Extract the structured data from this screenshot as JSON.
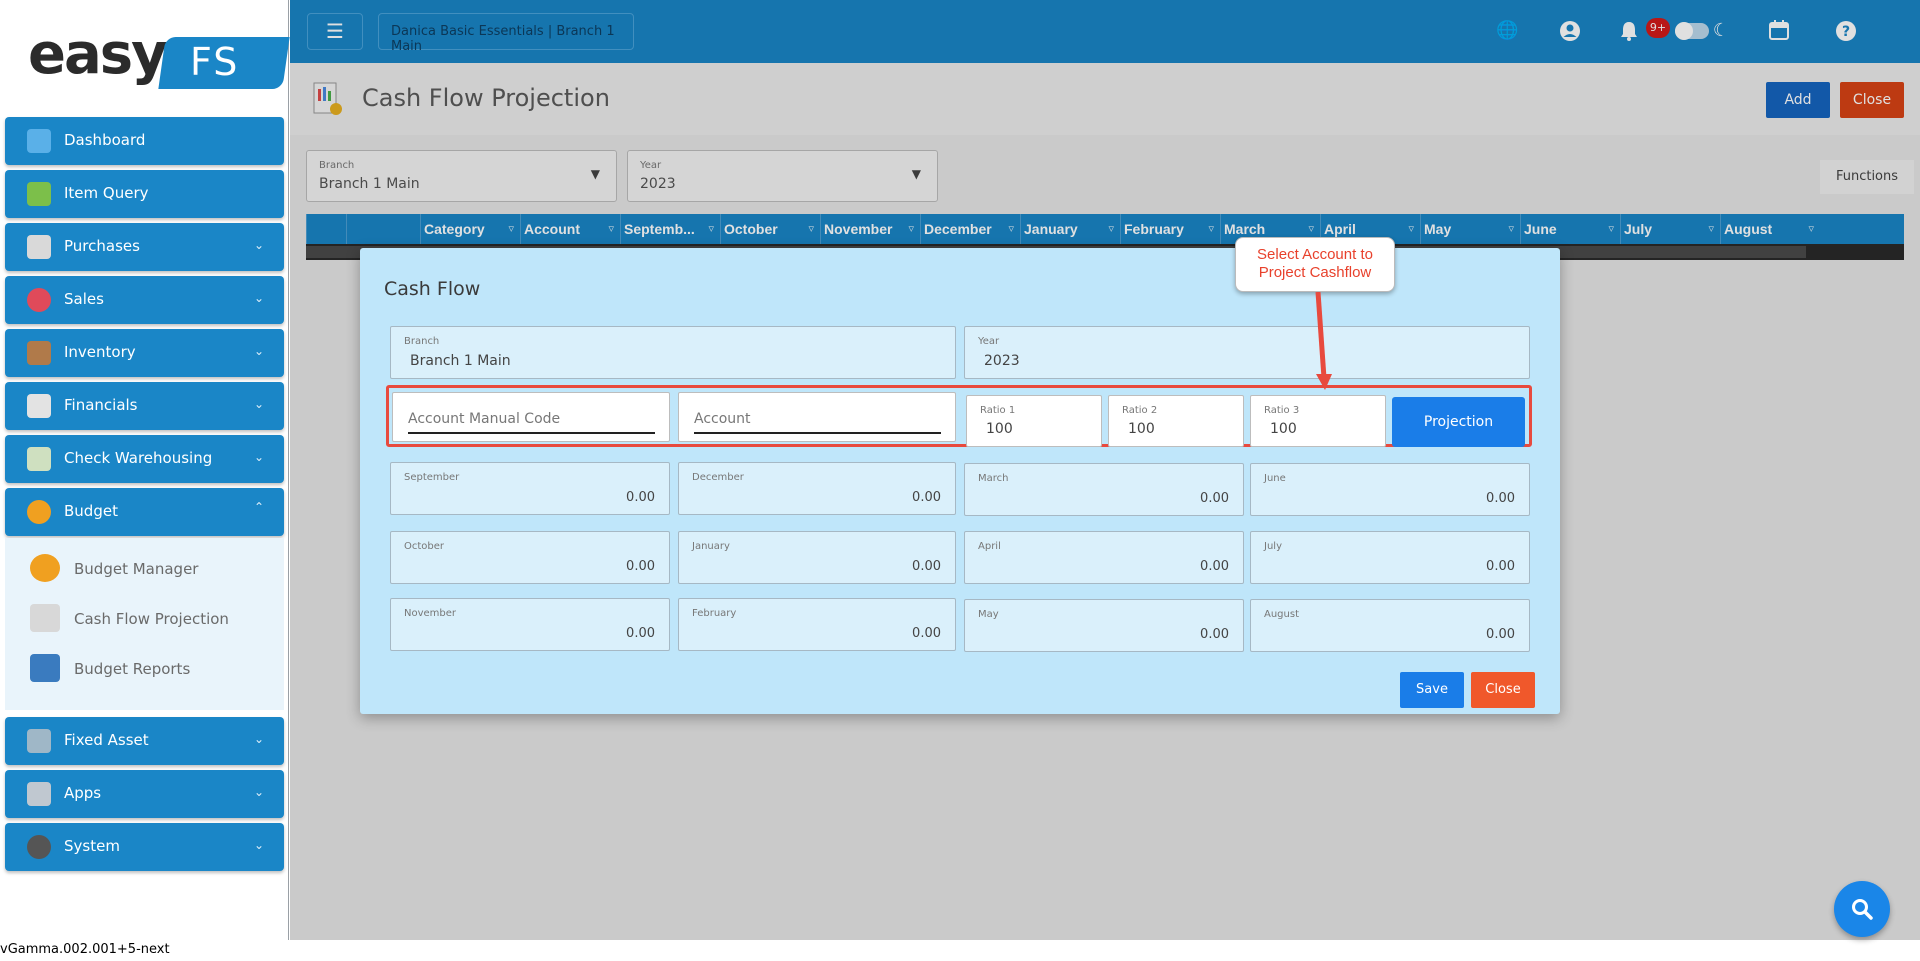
{
  "sidebar": {
    "logo_text": "easy",
    "logo_suffix": "FS",
    "items": [
      {
        "label": "Dashboard",
        "icon": "dashboard-icon"
      },
      {
        "label": "Item Query",
        "icon": "basket-icon"
      },
      {
        "label": "Purchases",
        "icon": "receipt-icon"
      },
      {
        "label": "Sales",
        "icon": "sale-tag-icon"
      },
      {
        "label": "Inventory",
        "icon": "boxes-icon"
      },
      {
        "label": "Financials",
        "icon": "ledger-icon"
      },
      {
        "label": "Check Warehousing",
        "icon": "check-icon"
      },
      {
        "label": "Budget",
        "icon": "pie-chart-icon"
      },
      {
        "label": "Fixed Asset",
        "icon": "gear-asset-icon"
      },
      {
        "label": "Apps",
        "icon": "apps-icon"
      },
      {
        "label": "System",
        "icon": "system-gear-icon"
      }
    ],
    "budget_sub": [
      {
        "label": "Budget Manager",
        "icon": "pie-chart-icon"
      },
      {
        "label": "Cash Flow Projection",
        "icon": "cashflow-icon"
      },
      {
        "label": "Budget Reports",
        "icon": "printer-icon"
      }
    ]
  },
  "version": "vGamma.002.001+5-next",
  "topbar": {
    "company": "Danica Basic Essentials | Branch 1 Main",
    "notification_count": "9+"
  },
  "page": {
    "title": "Cash Flow Projection",
    "add_label": "Add",
    "close_label": "Close",
    "functions_label": "Functions"
  },
  "filters": {
    "branch_label": "Branch",
    "branch_value": "Branch 1 Main",
    "year_label": "Year",
    "year_value": "2023"
  },
  "grid": {
    "columns": [
      "Category",
      "Account",
      "Septemb...",
      "October",
      "November",
      "December",
      "January",
      "February",
      "March",
      "April",
      "May",
      "June",
      "July",
      "August"
    ]
  },
  "modal": {
    "title": "Cash Flow",
    "branch_label": "Branch",
    "branch_value": "Branch 1 Main",
    "year_label": "Year",
    "year_value": "2023",
    "account_code_placeholder": "Account Manual Code",
    "account_placeholder": "Account",
    "ratio1_label": "Ratio 1",
    "ratio1_value": "100",
    "ratio2_label": "Ratio 2",
    "ratio2_value": "100",
    "ratio3_label": "Ratio 3",
    "ratio3_value": "100",
    "projection_label": "Projection",
    "months": [
      {
        "label": "September",
        "value": "0.00"
      },
      {
        "label": "December",
        "value": "0.00"
      },
      {
        "label": "March",
        "value": "0.00"
      },
      {
        "label": "June",
        "value": "0.00"
      },
      {
        "label": "October",
        "value": "0.00"
      },
      {
        "label": "January",
        "value": "0.00"
      },
      {
        "label": "April",
        "value": "0.00"
      },
      {
        "label": "July",
        "value": "0.00"
      },
      {
        "label": "November",
        "value": "0.00"
      },
      {
        "label": "February",
        "value": "0.00"
      },
      {
        "label": "May",
        "value": "0.00"
      },
      {
        "label": "August",
        "value": "0.00"
      }
    ],
    "save_label": "Save",
    "close_label": "Close"
  },
  "callout": {
    "line1": "Select Account to",
    "line2": "Project Cashflow"
  },
  "colors": {
    "brand": "#1a86c7",
    "modal_bg": "#bfe6fa",
    "primary_button": "#1a7de8",
    "danger_button": "#f0582b",
    "highlight": "#e84a3e"
  }
}
